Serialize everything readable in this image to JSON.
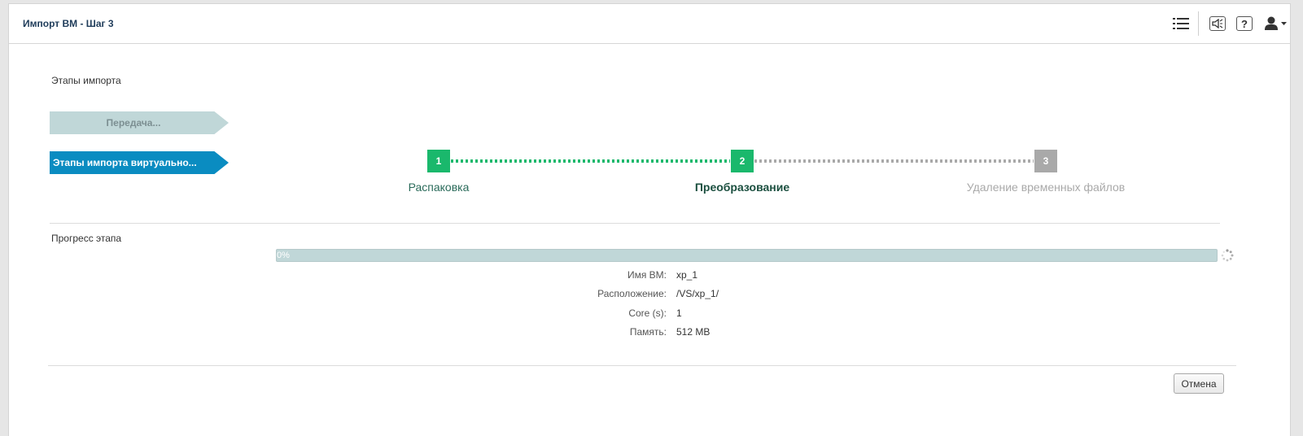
{
  "window": {
    "title": "Импорт ВМ - Шаг 3"
  },
  "toolbar": {
    "icons": [
      "menu-list-icon",
      "speaker-icon",
      "help-icon",
      "user-icon"
    ],
    "help_glyph": "?"
  },
  "stages": {
    "section_label": "Этапы импорта",
    "items": [
      {
        "label": "Передача...",
        "state": "done"
      },
      {
        "label": "Этапы импорта виртуально...",
        "state": "active"
      }
    ]
  },
  "steps": [
    {
      "number": "1",
      "label": "Распаковка",
      "state": "done"
    },
    {
      "number": "2",
      "label": "Преобразование",
      "state": "current"
    },
    {
      "number": "3",
      "label": "Удаление временных файлов",
      "state": "pending"
    }
  ],
  "progress": {
    "section_label": "Прогресс этапа",
    "value_text": "0%",
    "fraction": 0.0
  },
  "details": [
    {
      "key": "Имя ВМ:",
      "value": "xp_1"
    },
    {
      "key": "Расположение:",
      "value": "/VS/xp_1/"
    },
    {
      "key": "Core (s):",
      "value": "1"
    },
    {
      "key": "Память:",
      "value": "512 MB"
    }
  ],
  "footer": {
    "cancel_label": "Отмена"
  },
  "colors": {
    "accent_blue": "#0a8cc1",
    "step_green": "#1ab86c",
    "step_gray": "#a9a9a9",
    "progress_bg": "#c0d7d8"
  }
}
